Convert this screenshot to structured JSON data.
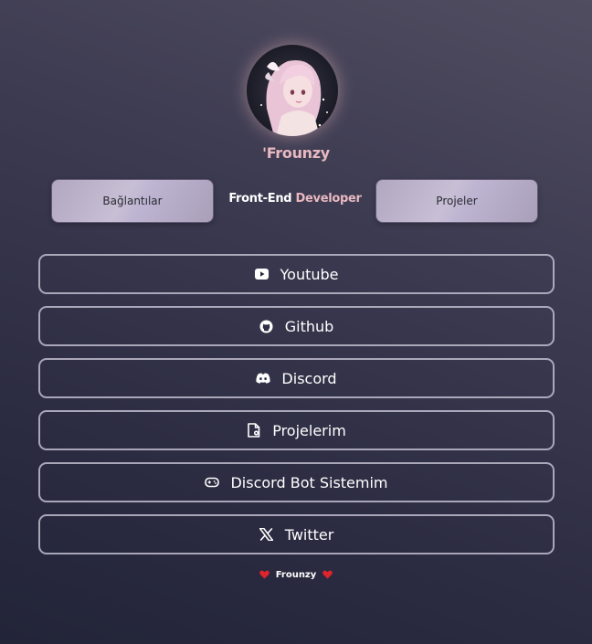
{
  "profile": {
    "avatar_icon": "anime-girl-avatar",
    "username": "'Frounzy"
  },
  "nav": {
    "left_button": "Bağlantılar",
    "right_button": "Projeler",
    "role_first": "Front-End",
    "role_second": "Developer"
  },
  "links": [
    {
      "label": "Youtube",
      "icon": "youtube-icon"
    },
    {
      "label": "Github",
      "icon": "github-icon"
    },
    {
      "label": "Discord",
      "icon": "discord-icon"
    },
    {
      "label": "Projelerim",
      "icon": "file-icon"
    },
    {
      "label": "Discord Bot Sistemim",
      "icon": "gamepad-icon"
    },
    {
      "label": "Twitter",
      "icon": "x-icon"
    }
  ],
  "footer": {
    "text": "Frounzy",
    "heart_icon": "heart-icon",
    "heart_color": "#e0242c"
  },
  "colors": {
    "accent_pink": "#e8b8c0",
    "text_white": "#ffffff"
  }
}
